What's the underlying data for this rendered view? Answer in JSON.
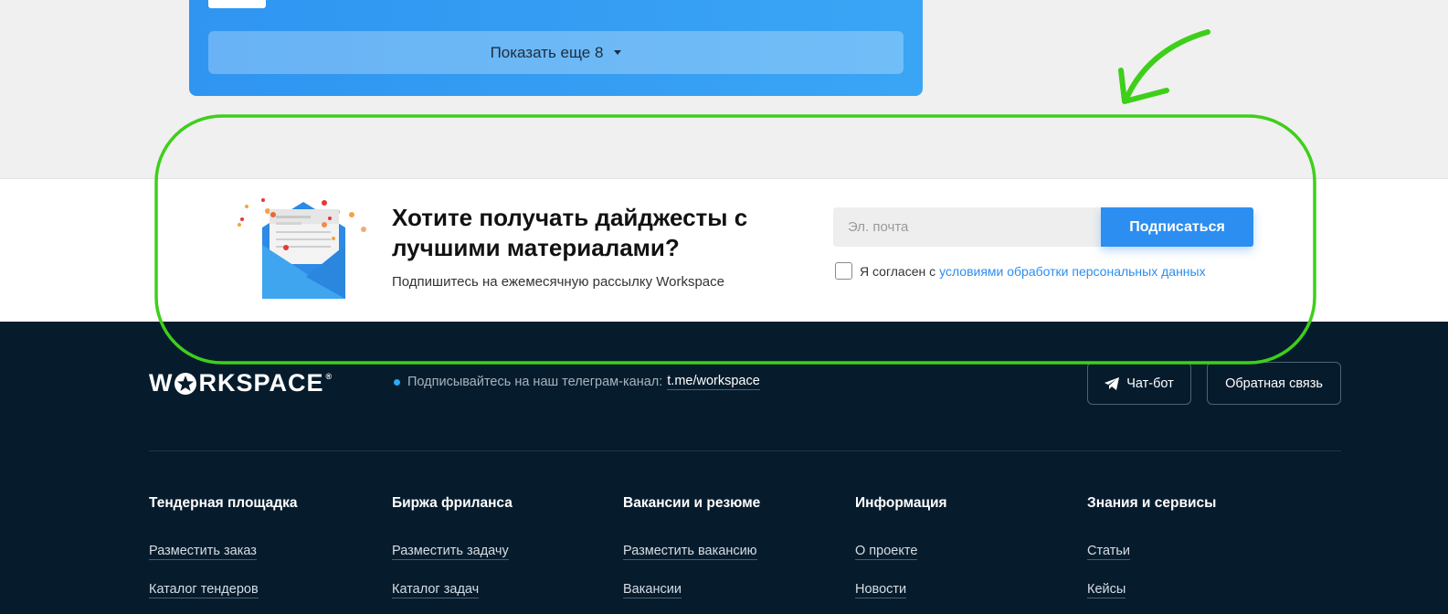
{
  "top": {
    "show_more_label": "Показать еще 8"
  },
  "subscribe": {
    "title": "Хотите получать дайджесты с лучшими материалами?",
    "subtitle": "Подпишитесь на ежемесячную рассылку Workspace",
    "email_placeholder": "Эл. почта",
    "button_label": "Подписаться",
    "agree_prefix": "Я согласен с",
    "agree_link": "условиями обработки персональных данных"
  },
  "footer": {
    "logo_text_pre": "W",
    "logo_text_post": "RKSPACE",
    "telegram_text": "Подписывайтесь на наш телеграм-канал:",
    "telegram_link": "t.me/workspace",
    "chat_bot_label": "Чат-бот",
    "feedback_label": "Обратная связь",
    "columns": [
      {
        "heading": "Тендерная площадка",
        "links": [
          "Разместить заказ",
          "Каталог тендеров"
        ]
      },
      {
        "heading": "Биржа фриланса",
        "links": [
          "Разместить задачу",
          "Каталог задач"
        ]
      },
      {
        "heading": "Вакансии и резюме",
        "links": [
          "Разместить вакансию",
          "Вакансии"
        ]
      },
      {
        "heading": "Информация",
        "links": [
          "О проекте",
          "Новости"
        ]
      },
      {
        "heading": "Знания и сервисы",
        "links": [
          "Статьи",
          "Кейсы"
        ]
      }
    ]
  },
  "colors": {
    "accent_blue": "#2b8ef0",
    "footer_bg": "#061c2d",
    "annotation_green": "#3ecf1a"
  }
}
